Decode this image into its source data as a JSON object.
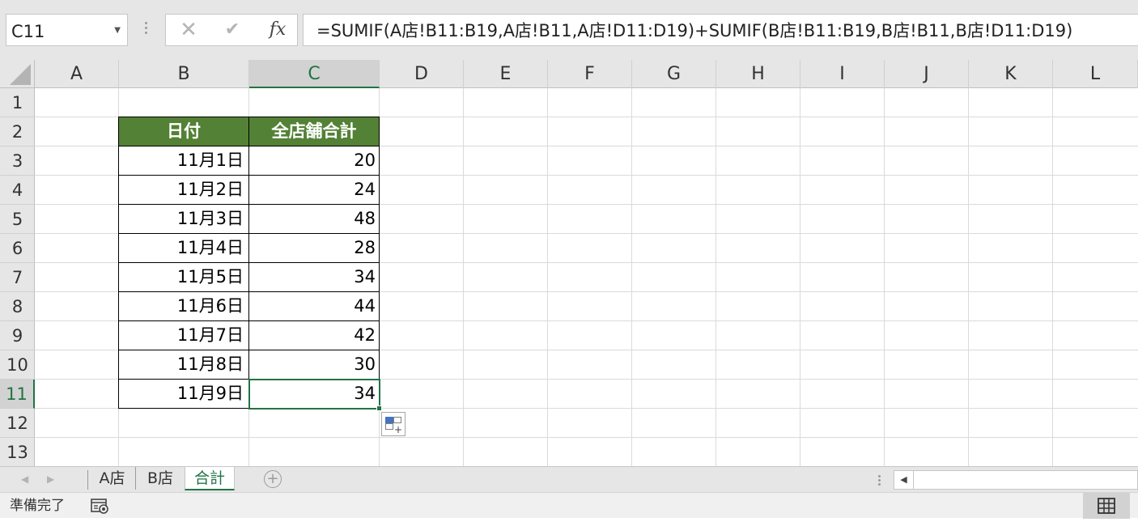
{
  "formula_bar": {
    "name_box": "C11",
    "cancel_icon": "✕",
    "enter_icon": "✔",
    "fx_label": "fx",
    "formula": "=SUMIF(A店!B11:B19,A店!B11,A店!D11:D19)+SUMIF(B店!B11:B19,B店!B11,B店!D11:D19)"
  },
  "columns": [
    "A",
    "B",
    "C",
    "D",
    "E",
    "F",
    "G",
    "H",
    "I",
    "J",
    "K",
    "L"
  ],
  "active_column": "C",
  "rows": [
    "1",
    "2",
    "3",
    "4",
    "5",
    "6",
    "7",
    "8",
    "9",
    "10",
    "11",
    "12",
    "13"
  ],
  "active_row": "11",
  "table": {
    "headers": [
      "日付",
      "全店舗合計"
    ],
    "rows": [
      {
        "date": "11月1日",
        "total": "20"
      },
      {
        "date": "11月2日",
        "total": "24"
      },
      {
        "date": "11月3日",
        "total": "48"
      },
      {
        "date": "11月4日",
        "total": "28"
      },
      {
        "date": "11月5日",
        "total": "34"
      },
      {
        "date": "11月6日",
        "total": "44"
      },
      {
        "date": "11月7日",
        "total": "42"
      },
      {
        "date": "11月8日",
        "total": "30"
      },
      {
        "date": "11月9日",
        "total": "34"
      }
    ]
  },
  "sheet_tabs": [
    {
      "label": "A店",
      "active": false
    },
    {
      "label": "B店",
      "active": false
    },
    {
      "label": "合計",
      "active": true
    }
  ],
  "add_sheet_icon": "+",
  "status": {
    "text": "準備完了"
  },
  "colors": {
    "header_green": "#538135",
    "excel_green": "#217346"
  }
}
